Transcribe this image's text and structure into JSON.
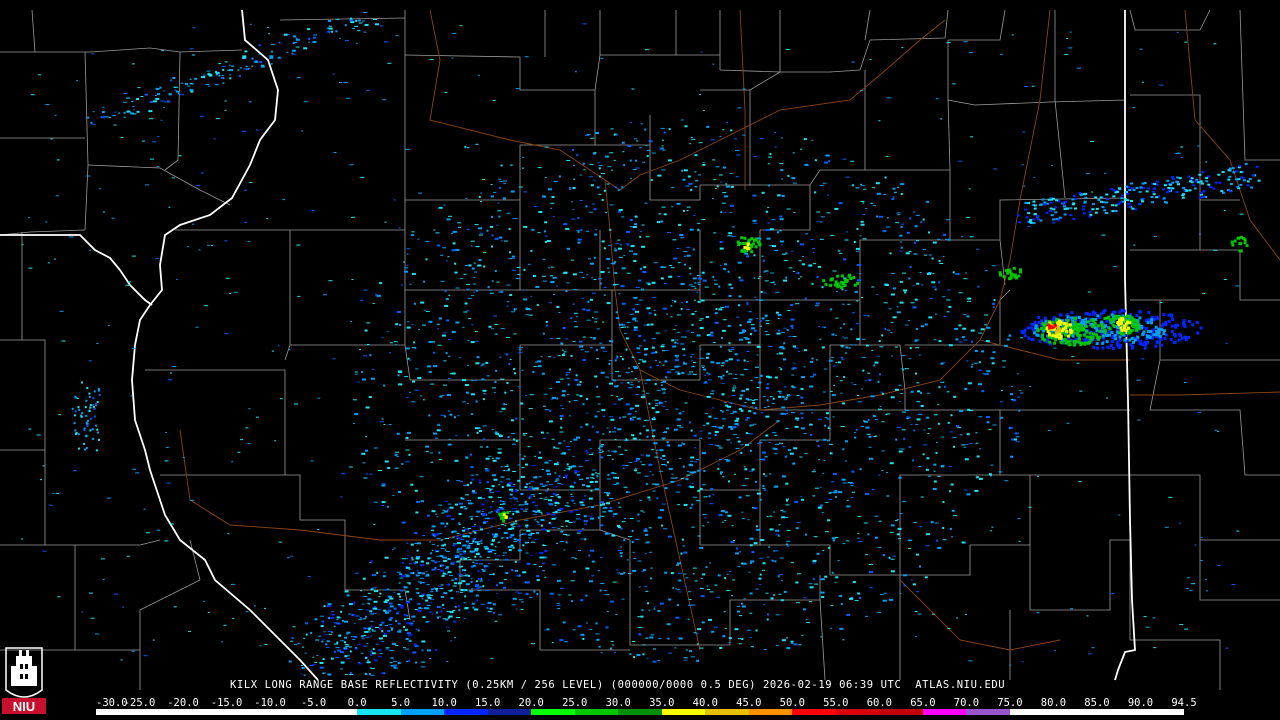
{
  "product_line": "KILX LONG RANGE BASE REFLECTIVITY (0.25KM / 256 LEVEL) (000000/0000 0.5 DEG) 2026-02-19 06:39 UTC  ATLAS.NIU.EDU",
  "scale": {
    "labels": [
      "-30.0",
      "-25.0",
      "-20.0",
      "-15.0",
      "-10.0",
      "-5.0",
      "0.0",
      "5.0",
      "10.0",
      "15.0",
      "20.0",
      "25.0",
      "30.0",
      "35.0",
      "40.0",
      "45.0",
      "50.0",
      "55.0",
      "60.0",
      "65.0",
      "70.0",
      "75.0",
      "80.0",
      "85.0",
      "90.0",
      "94.5"
    ],
    "colors": [
      "#ffffff",
      "#ffffff",
      "#ffffff",
      "#ffffff",
      "#ffffff",
      "#ffffff",
      "#19e6f5",
      "#00a0f5",
      "#0026ff",
      "#0f1f9a",
      "#00ff00",
      "#00c800",
      "#009000",
      "#ffff00",
      "#e7c000",
      "#ff9000",
      "#ff0000",
      "#d60000",
      "#c00000",
      "#ff00ff",
      "#9955c9",
      "#ffffff",
      "#ffffff",
      "#ffffff",
      "#ffffff"
    ]
  },
  "logo_text": "NIU",
  "logo_colors": {
    "red": "#c8102e",
    "white": "#ffffff",
    "black": "#000000"
  }
}
